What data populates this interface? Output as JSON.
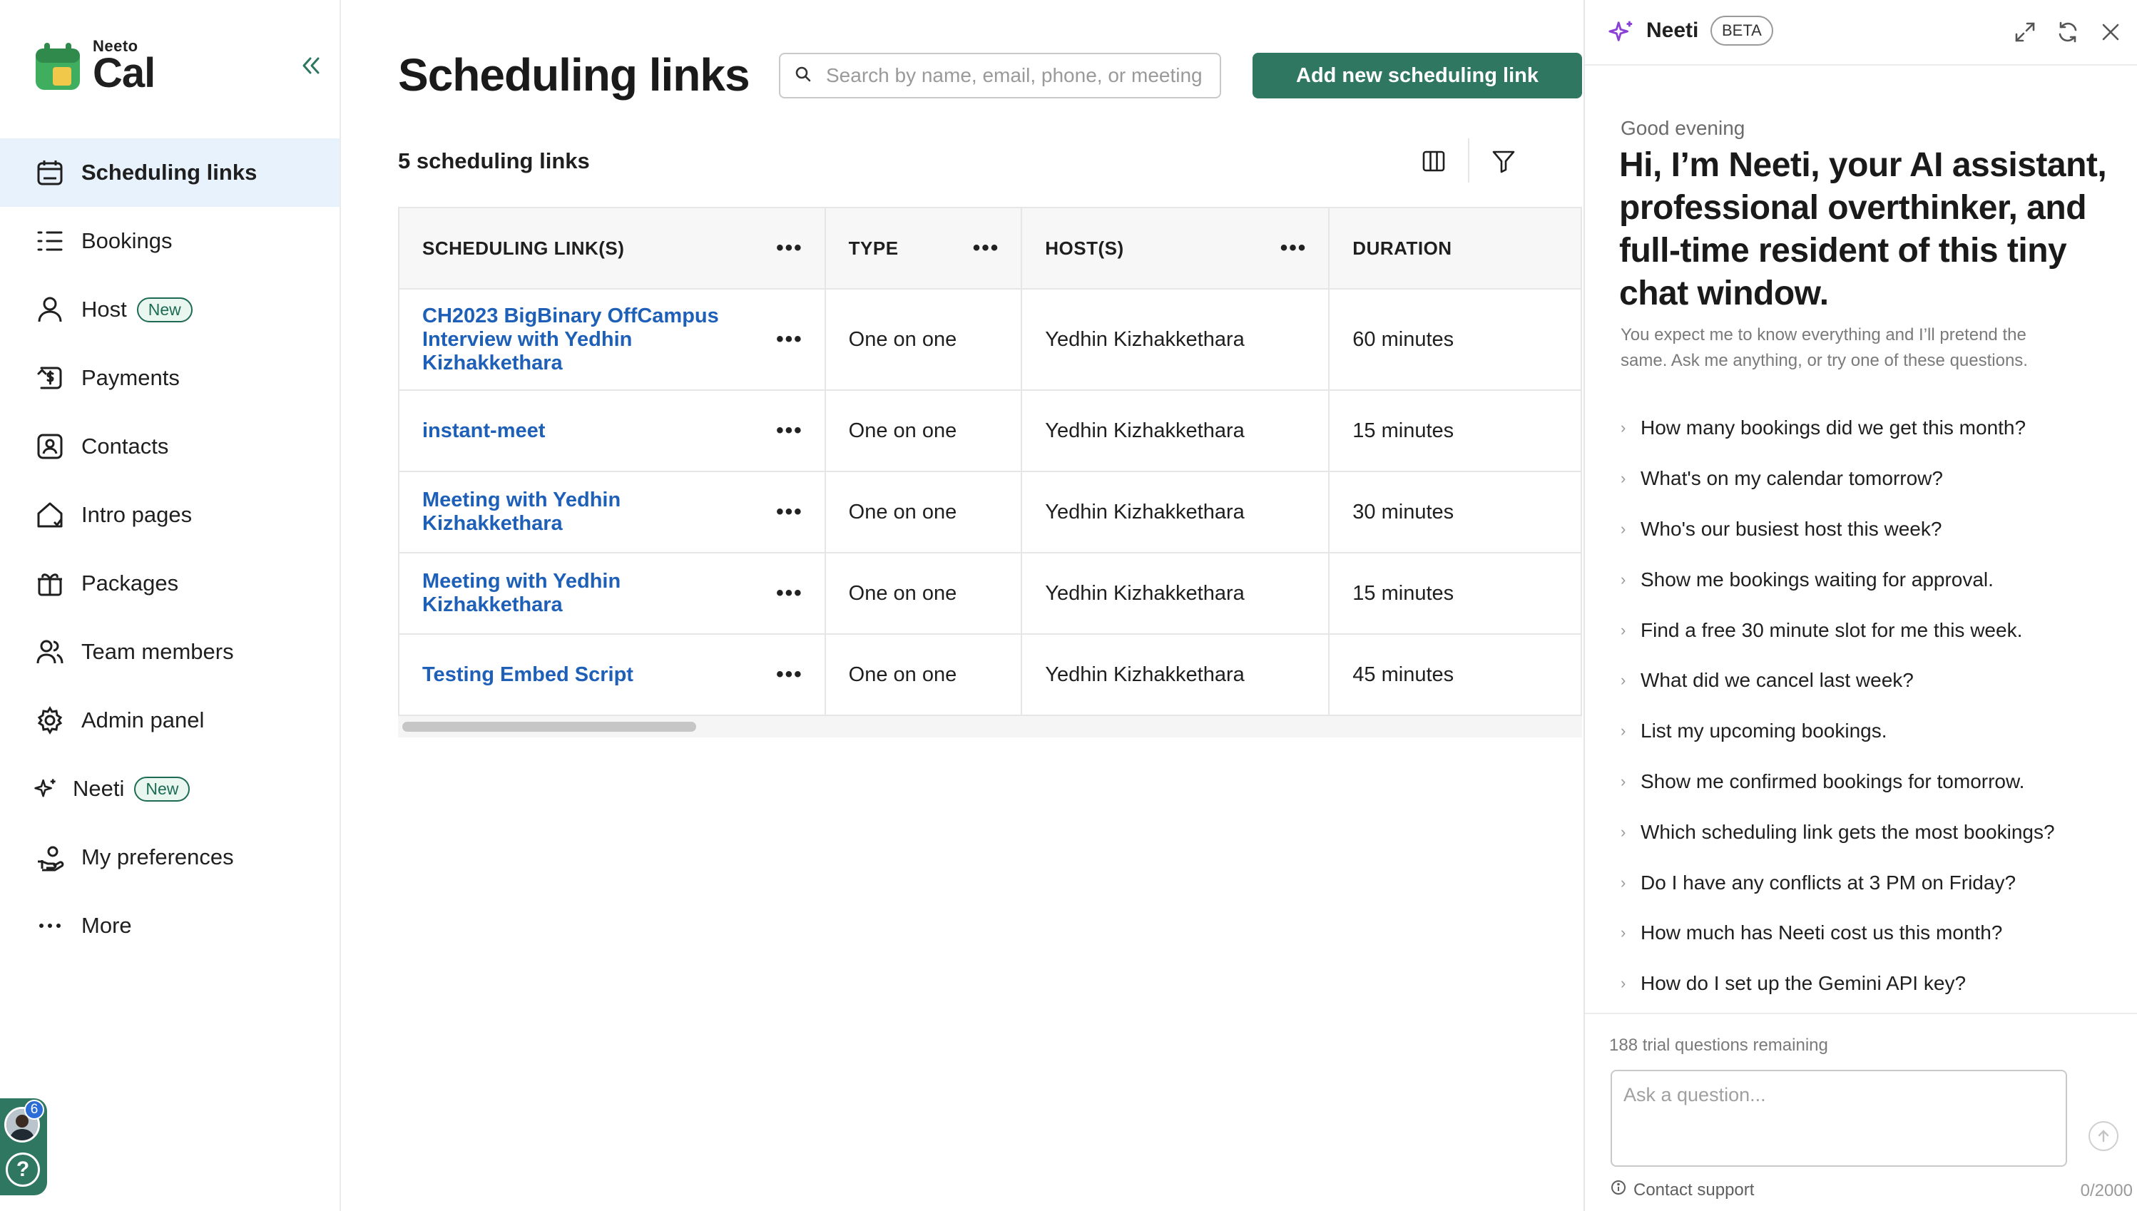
{
  "app": {
    "logo_small": "Neeto",
    "logo_big": "Cal"
  },
  "sidebar": {
    "items": [
      {
        "label": "Scheduling links",
        "icon": "calendar-icon",
        "active": true
      },
      {
        "label": "Bookings",
        "icon": "list-icon"
      },
      {
        "label": "Host",
        "icon": "user-icon",
        "badge": "New"
      },
      {
        "label": "Payments",
        "icon": "payments-icon"
      },
      {
        "label": "Contacts",
        "icon": "contact-card-icon"
      },
      {
        "label": "Intro pages",
        "icon": "home-icon"
      },
      {
        "label": "Packages",
        "icon": "gift-icon"
      },
      {
        "label": "Team members",
        "icon": "users-icon"
      },
      {
        "label": "Admin panel",
        "icon": "gear-icon"
      },
      {
        "label": "Neeti",
        "icon": "sparkle-icon",
        "badge": "New"
      },
      {
        "label": "My preferences",
        "icon": "preferences-icon"
      },
      {
        "label": "More",
        "icon": "more-dots-icon"
      }
    ],
    "notification_count": "6"
  },
  "main": {
    "title": "Scheduling links",
    "search_placeholder": "Search by name, email, phone, or meeting",
    "add_button": "Add new scheduling link",
    "count_label": "5 scheduling links",
    "columns": [
      "SCHEDULING LINK(S)",
      "TYPE",
      "HOST(S)",
      "DURATION"
    ],
    "rows": [
      {
        "name": "CH2023 BigBinary OffCampus Interview with Yedhin Kizhakkethara",
        "type": "One on one",
        "host": "Yedhin Kizhakkethara",
        "duration": "60 minutes"
      },
      {
        "name": "instant-meet",
        "type": "One on one",
        "host": "Yedhin Kizhakkethara",
        "duration": "15 minutes"
      },
      {
        "name": "Meeting with Yedhin Kizhakkethara",
        "type": "One on one",
        "host": "Yedhin Kizhakkethara",
        "duration": "30 minutes"
      },
      {
        "name": "Meeting with Yedhin Kizhakkethara",
        "type": "One on one",
        "host": "Yedhin Kizhakkethara",
        "duration": "15 minutes"
      },
      {
        "name": "Testing Embed Script",
        "type": "One on one",
        "host": "Yedhin Kizhakkethara",
        "duration": "45 minutes"
      }
    ]
  },
  "neeti": {
    "title": "Neeti",
    "beta": "BETA",
    "greeting": "Good evening",
    "headline": "Hi, I’m Neeti, your AI assistant, professional overthinker, and full-time resident of this tiny chat window.",
    "subtext": "You expect me to know everything and I’ll pretend the same. Ask me anything, or try one of these questions.",
    "questions": [
      "How many bookings did we get this month?",
      "What's on my calendar tomorrow?",
      "Who's our busiest host this week?",
      "Show me bookings waiting for approval.",
      "Find a free 30 minute slot for me this week.",
      "What did we cancel last week?",
      "List my upcoming bookings.",
      "Show me confirmed bookings for tomorrow.",
      "Which scheduling link gets the most bookings?",
      "Do I have any conflicts at 3 PM on Friday?",
      "How much has Neeti cost us this month?",
      "How do I set up the Gemini API key?"
    ],
    "trial_text": "188 trial questions remaining",
    "ask_placeholder": "Ask a question...",
    "contact_support": "Contact support",
    "char_count": "0/2000"
  },
  "colors": {
    "brand": "#2f7761",
    "link": "#1e5fb8",
    "active_bg": "#e8f2fc"
  }
}
